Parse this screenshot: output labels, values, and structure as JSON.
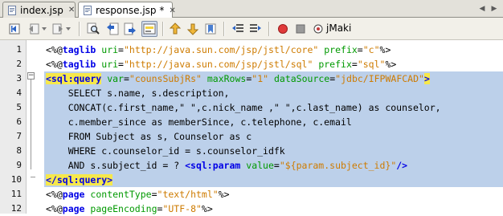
{
  "tabs": [
    {
      "label": "index.jsp",
      "close": "✕"
    },
    {
      "label": "response.jsp *",
      "close": "✕"
    }
  ],
  "tab_nav": {
    "left": "◀",
    "right": "▶"
  },
  "toolbar": {
    "jmaki_label": "jMaki"
  },
  "editor": {
    "line_numbers": [
      "1",
      "2",
      "3",
      "4",
      "5",
      "6",
      "7",
      "8",
      "9",
      "10",
      "11",
      "12"
    ],
    "lines": [
      {
        "num": "1",
        "selected": false,
        "segs": [
          [
            "d",
            "<%@"
          ],
          [
            "k",
            "taglib"
          ],
          [
            "t",
            " "
          ],
          [
            "a",
            "uri"
          ],
          [
            "t",
            "="
          ],
          [
            "v",
            "\"http://java.sun.com/jsp/jstl/core\""
          ],
          [
            "t",
            " "
          ],
          [
            "a",
            "prefix"
          ],
          [
            "t",
            "="
          ],
          [
            "v",
            "\"c\""
          ],
          [
            "d",
            "%>"
          ]
        ]
      },
      {
        "num": "2",
        "selected": false,
        "segs": [
          [
            "d",
            "<%@"
          ],
          [
            "k",
            "taglib"
          ],
          [
            "t",
            " "
          ],
          [
            "a",
            "uri"
          ],
          [
            "t",
            "="
          ],
          [
            "v",
            "\"http://java.sun.com/jsp/jstl/sql\""
          ],
          [
            "t",
            " "
          ],
          [
            "a",
            "prefix"
          ],
          [
            "t",
            "="
          ],
          [
            "v",
            "\"sql\""
          ],
          [
            "d",
            "%>"
          ]
        ]
      },
      {
        "num": "3",
        "selected": true,
        "segs": [
          [
            "hlk",
            "<sql:query"
          ],
          [
            "t",
            " "
          ],
          [
            "a",
            "var"
          ],
          [
            "t",
            "="
          ],
          [
            "v",
            "\"counsSubjRs\""
          ],
          [
            "t",
            " "
          ],
          [
            "a",
            "maxRows"
          ],
          [
            "t",
            "="
          ],
          [
            "v",
            "\"1\""
          ],
          [
            "t",
            " "
          ],
          [
            "a",
            "dataSource"
          ],
          [
            "t",
            "="
          ],
          [
            "v",
            "\"jdbc/IFPWAFCAD\""
          ],
          [
            "hlk",
            ">"
          ]
        ]
      },
      {
        "num": "4",
        "selected": true,
        "segs": [
          [
            "t",
            "    SELECT s.name, s.description,"
          ]
        ]
      },
      {
        "num": "5",
        "selected": true,
        "segs": [
          [
            "t",
            "    CONCAT(c.first_name,\" \",c.nick_name ,\" \",c.last_name) as counselor,"
          ]
        ]
      },
      {
        "num": "6",
        "selected": true,
        "segs": [
          [
            "t",
            "    c.member_since as memberSince, c.telephone, c.email"
          ]
        ]
      },
      {
        "num": "7",
        "selected": true,
        "segs": [
          [
            "t",
            "    FROM Subject as s, Counselor as c"
          ]
        ]
      },
      {
        "num": "8",
        "selected": true,
        "segs": [
          [
            "t",
            "    WHERE c.counselor_id = s.counselor_idfk"
          ]
        ]
      },
      {
        "num": "9",
        "selected": true,
        "segs": [
          [
            "t",
            "    AND s.subject_id = ? "
          ],
          [
            "k",
            "<sql:param"
          ],
          [
            "t",
            " "
          ],
          [
            "a",
            "value"
          ],
          [
            "t",
            "="
          ],
          [
            "v",
            "\"${param.subject_id}\""
          ],
          [
            "k",
            "/>"
          ]
        ]
      },
      {
        "num": "10",
        "selected": true,
        "segs": [
          [
            "hlk",
            "</sql:query"
          ],
          [
            "hlk",
            ">"
          ]
        ]
      },
      {
        "num": "11",
        "selected": false,
        "segs": [
          [
            "d",
            "<%@"
          ],
          [
            "k",
            "page"
          ],
          [
            "t",
            " "
          ],
          [
            "a",
            "contentType"
          ],
          [
            "t",
            "="
          ],
          [
            "v",
            "\"text/html\""
          ],
          [
            "d",
            "%>"
          ]
        ]
      },
      {
        "num": "12",
        "selected": false,
        "segs": [
          [
            "d",
            "<%@"
          ],
          [
            "k",
            "page"
          ],
          [
            "t",
            " "
          ],
          [
            "a",
            "pageEncoding"
          ],
          [
            "t",
            "="
          ],
          [
            "v",
            "\"UTF-8\""
          ],
          [
            "d",
            "%>"
          ]
        ]
      }
    ]
  },
  "colors": {
    "keyword": "#0000e6",
    "attribute": "#009900",
    "value": "#ce7b00",
    "selection": "#bcd0ea",
    "match_highlight": "#f6e84b"
  },
  "icons": [
    "first-bookmark-icon",
    "back-icon",
    "forward-icon",
    "find-icon",
    "find-previous-icon",
    "find-next-icon",
    "toggle-highlight-icon",
    "prev-bookmark-icon",
    "next-bookmark-icon",
    "toggle-bookmark-icon",
    "shift-left-icon",
    "shift-right-icon",
    "record-macro-icon",
    "stop-macro-icon",
    "jmaki-icon"
  ]
}
